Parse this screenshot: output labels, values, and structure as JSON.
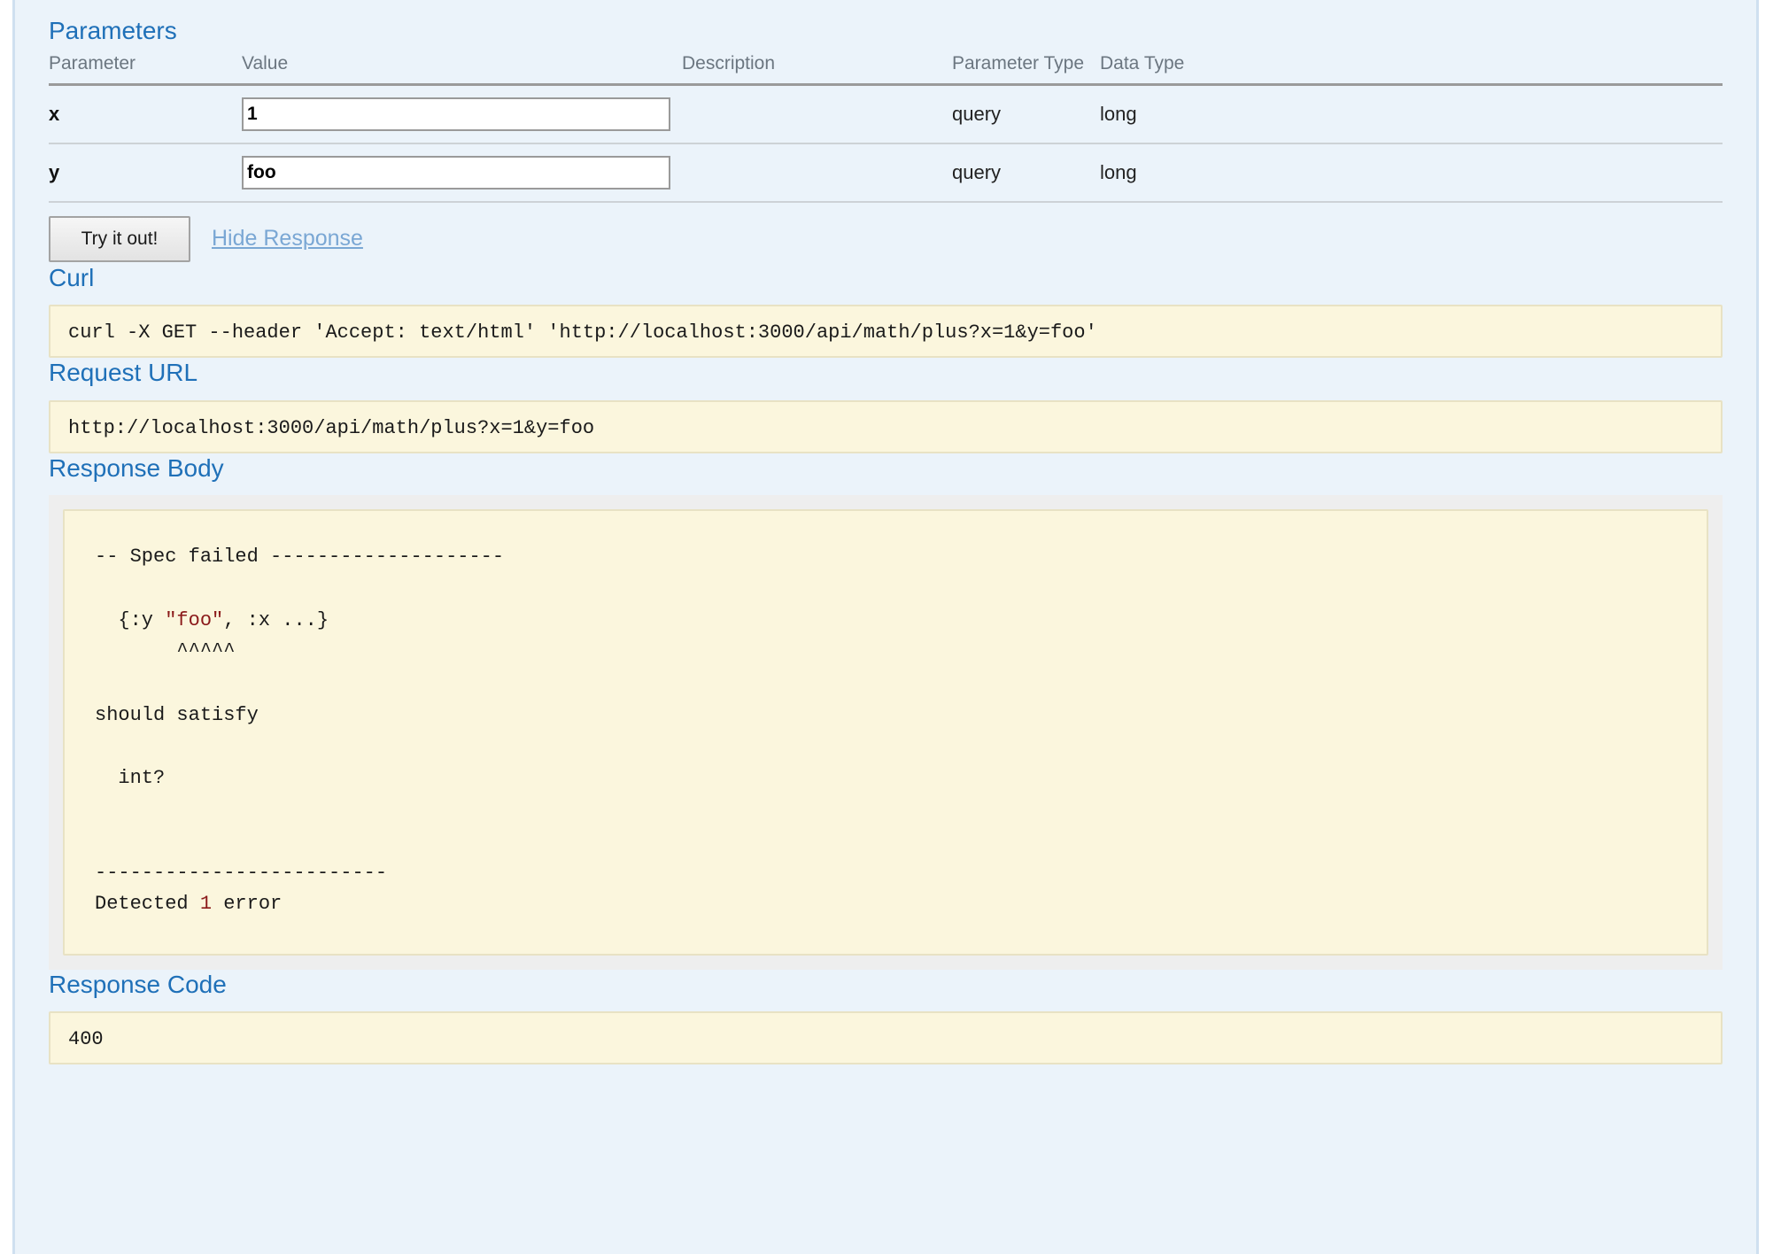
{
  "parameters": {
    "heading": "Parameters",
    "columns": [
      "Parameter",
      "Value",
      "Description",
      "Parameter Type",
      "Data Type"
    ],
    "rows": [
      {
        "name": "x",
        "value": "1",
        "placeholder": "",
        "description": "",
        "parameter_type": "query",
        "data_type": "long"
      },
      {
        "name": "y",
        "value": "foo",
        "placeholder": "",
        "description": "",
        "parameter_type": "query",
        "data_type": "long"
      }
    ]
  },
  "actions": {
    "submit_label": "Try it out!",
    "hide_response_label": "Hide Response"
  },
  "curl": {
    "heading": "Curl",
    "command": "curl -X GET --header 'Accept: text/html' 'http://localhost:3000/api/math/plus?x=1&y=foo'"
  },
  "request_url": {
    "heading": "Request URL",
    "url": "http://localhost:3000/api/math/plus?x=1&y=foo"
  },
  "response_body": {
    "heading": "Response Body",
    "line_spec_failed": "-- Spec failed --------------------",
    "line_value_prefix": "  {:y ",
    "line_value_string": "\"foo\"",
    "line_value_suffix": ", :x ...}",
    "line_carets": "       ^^^^^",
    "line_should_satisfy": "should satisfy",
    "line_predicate": "  int?",
    "line_divider": "-------------------------",
    "line_detected_prefix": "Detected ",
    "line_detected_count": "1",
    "line_detected_suffix": " error"
  },
  "response_code": {
    "heading": "Response Code",
    "code": "400"
  },
  "colors": {
    "panel_background": "#ebf3fa",
    "panel_border": "#cfe0f0",
    "heading_blue": "#1f70b8",
    "link_blue": "#7aa7d4",
    "code_background": "#fbf6dd",
    "code_border": "#e8e2c4",
    "response_wrapper": "#eeeeee",
    "error_red": "#8b1a1a"
  }
}
